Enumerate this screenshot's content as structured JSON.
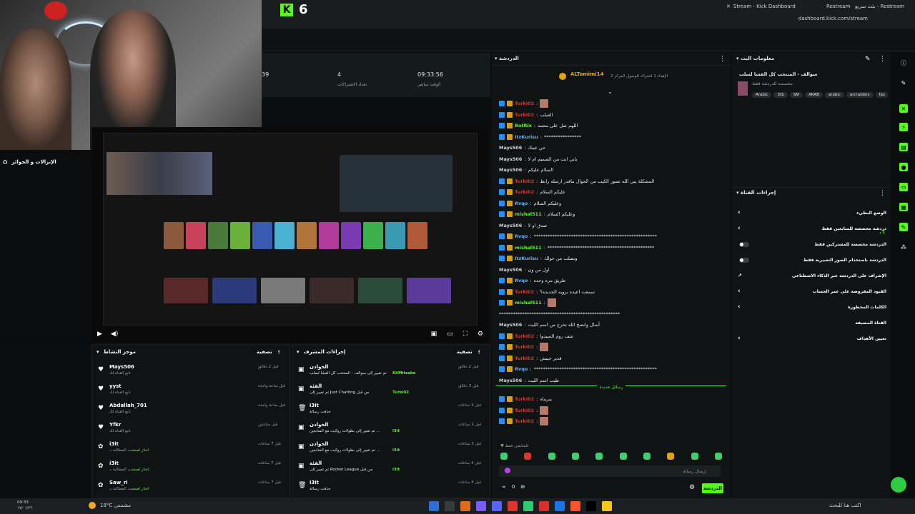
{
  "browser": {
    "tab_active": "Stream - Kick Dashboard",
    "tab_other": "Restream",
    "tab_search": "بثث سريع - Restream",
    "url": "dashboard.kick.com/stream"
  },
  "header": {
    "viewer_count": "6"
  },
  "stats": {
    "item1_value": "4",
    "item1_label": "تعداد الاشتراكات",
    "item2_value": "09:33:56",
    "item2_label": "الوقت مباشر",
    "item0_value": "39"
  },
  "left_panel": {
    "title": "الإنزالات و الجوائز"
  },
  "activity": {
    "title": "موجز النشاط",
    "filter": "تصفية",
    "rows": [
      {
        "user": "Mays506",
        "sub": "تابع القناة لك",
        "time": "قبل 2 دقائق"
      },
      {
        "user": "yyst",
        "sub": "تابع القناة لك",
        "time": "قبل ساعة واحدة"
      },
      {
        "user": "Abdallah_701",
        "sub": "تابع القناة لك",
        "time": "قبل ساعة واحدة"
      },
      {
        "user": "Yfkr",
        "sub": "تابع القناة لك",
        "time": "قبل ساعتين"
      },
      {
        "user": "i3it",
        "sub": "تمت المطالبة بـ",
        "extra": "اختار لعبه",
        "time": "قبل 7 ساعات"
      },
      {
        "user": "i3it",
        "sub": "تمت المطالبة بـ",
        "extra": "اختار لعبه",
        "time": "قبل 7 ساعات"
      },
      {
        "user": "Saw_ri",
        "sub": "تمت المطالبة بـ",
        "extra": "اختار لعبه",
        "time": "قبل 7 ساعات"
      }
    ]
  },
  "mod_actions": {
    "title": "إجراءات المشرف",
    "filter": "تصفية",
    "rows": [
      {
        "who": "الخوادن",
        "desc": "تم تغيير إلى سوالف - المنتخب كل الفشا لسلب",
        "by": "KiiMitzako",
        "time": "قبل 2 دقائق"
      },
      {
        "who": "الفئة",
        "desc": "تم تغيير إلى Just Chatting من قبل",
        "by": "Turki02",
        "time": "قبل 3 دقائق"
      },
      {
        "who": "i3it",
        "desc": "حذفت رسالة",
        "by": "",
        "time": "قبل 3 ساعات"
      },
      {
        "who": "الخوادن",
        "desc": "تم تغيير إلى بطولات روكيت مع المتابعين ...",
        "by": "i3it",
        "time": "قبل 3 ساعات"
      },
      {
        "who": "الخوادن",
        "desc": "تم تغيير إلى بطولات روكيت مع المتابعين ...",
        "by": "i3it",
        "time": "قبل 3 ساعات"
      },
      {
        "who": "الفئة",
        "desc": "تم تغيير إلى Rocket League من قبل",
        "by": "i3it",
        "time": "قبل 4 ساعات"
      },
      {
        "who": "i3it",
        "desc": "حذفت رسالة",
        "by": "",
        "time": "قبل 4 ساعات"
      }
    ]
  },
  "chat": {
    "title": "الدردشة",
    "pinned_user": "ALTamimi14",
    "pinned_text": "الإهداء 1 اشتراك للوصول المركز 2",
    "messages": [
      {
        "user": "Turki02",
        "color": "red",
        "text": ""
      },
      {
        "user": "Turki02",
        "color": "red",
        "text": "الصلب"
      },
      {
        "user": "BotRix",
        "color": "green",
        "text": "اللهم صل على محمد"
      },
      {
        "user": "ItzKurisu",
        "color": "blue",
        "text": "****************"
      },
      {
        "user": "Mays506",
        "color": "white",
        "text": "حي عينك"
      },
      {
        "user": "Mays506",
        "color": "white",
        "text": "يابي انت من الصميم ام لا"
      },
      {
        "user": "Mays506",
        "color": "white",
        "text": "السلام عليكم"
      },
      {
        "user": "Turki02",
        "color": "red",
        "text": "المشكلة يبي الله تصور الكيب من الجوال ماقدر ارسله رابط"
      },
      {
        "user": "Turki02",
        "color": "red",
        "text": "عليكم السلام"
      },
      {
        "user": "Rvqo",
        "color": "blue",
        "text": "وعليكم السلام"
      },
      {
        "user": "mishal511",
        "color": "green",
        "text": "وعليكم السلام"
      },
      {
        "user": "Mays506",
        "color": "white",
        "text": "صدق او لا"
      },
      {
        "user": "Rvqo",
        "color": "blue",
        "text": "*****************************************************"
      },
      {
        "user": "mishal511",
        "color": "green",
        "text": "**********************************************"
      },
      {
        "user": "ItzKurisu",
        "color": "blue",
        "text": "ونصلب من حولك"
      },
      {
        "user": "Mays506",
        "color": "white",
        "text": "اول من ون"
      },
      {
        "user": "Rvqo",
        "color": "blue",
        "text": "طريق مره وحده"
      },
      {
        "user": "Turki02",
        "color": "red",
        "text": "سمعت اعيده برويه الجديده؟"
      },
      {
        "user": "mishal511",
        "color": "green",
        "text": ""
      },
      {
        "user": "",
        "color": "white",
        "text": "****************************************************"
      },
      {
        "user": "Mays506",
        "color": "white",
        "text": "أسال وانصح الله تخرج من اسم الليت"
      },
      {
        "user": "Turki02",
        "color": "red",
        "text": "شف روم السيدوا"
      },
      {
        "user": "Turki02",
        "color": "red",
        "text": ""
      },
      {
        "user": "Turki02",
        "color": "red",
        "text": "قدير جيبش"
      },
      {
        "user": "Rvqo",
        "color": "blue",
        "text": "*****************************************************"
      },
      {
        "user": "Mays506",
        "color": "white",
        "text": "طيب اسم الليت"
      }
    ],
    "new_messages_label": "رسائل جديدة",
    "after_new": [
      {
        "user": "Turki02",
        "color": "red",
        "text": "يبريناه"
      },
      {
        "user": "Turki02",
        "color": "red",
        "text": ""
      },
      {
        "user": "Turki02",
        "color": "red",
        "text": ""
      }
    ],
    "followers_only": "للمتابعين فقط",
    "input_placeholder": "إرسال رسالة",
    "send_label": "الدردشة",
    "viewer_zero": "0"
  },
  "stream_info": {
    "title": "معلومات البث",
    "stream_title": "سوالف - المنتخب كل الفشا لسلب",
    "category": "مخصصة للدردشة فقط",
    "tags": [
      "Arabic",
      "3rb",
      "SM",
      "ARAB",
      "arabic",
      "arcraiders",
      "fps"
    ]
  },
  "channel_settings": {
    "title": "إجراءات القناة",
    "items": [
      {
        "label": "الوضع البطيء",
        "control": "arrow"
      },
      {
        "label": "دردشة مخصصة للمتابعين فقط",
        "sub": "1 د",
        "control": "arrow"
      },
      {
        "label": "الدردشة مخصصة للمشتركين فقط",
        "control": "toggle"
      },
      {
        "label": "الدردشة باستخدام الصور التعبيرية فقط",
        "control": "toggle"
      },
      {
        "label": "الإشراف على الدردشة عبر الذكاء الاصطناعي",
        "control": "external"
      },
      {
        "label": "القيود المفروضة على عمر الحساب",
        "control": "arrow"
      },
      {
        "label": "الكلمات المحظورة",
        "control": "arrow"
      },
      {
        "label": "القناة المضيفة",
        "control": "none"
      },
      {
        "label": "تعيين الأهداف",
        "control": "arrow"
      }
    ]
  },
  "taskbar": {
    "weather": "18°C",
    "weather_label": "مشمس",
    "search": "اكتب هنا للبحث",
    "time": "09:33",
    "date": "١٧/٠١/٢٦"
  },
  "colors": {
    "accent": "#53fc18",
    "panel": "#0f1314",
    "bg": "#0b0e0f",
    "red_user": "#e0352b",
    "blue_user": "#5fb3ff"
  }
}
